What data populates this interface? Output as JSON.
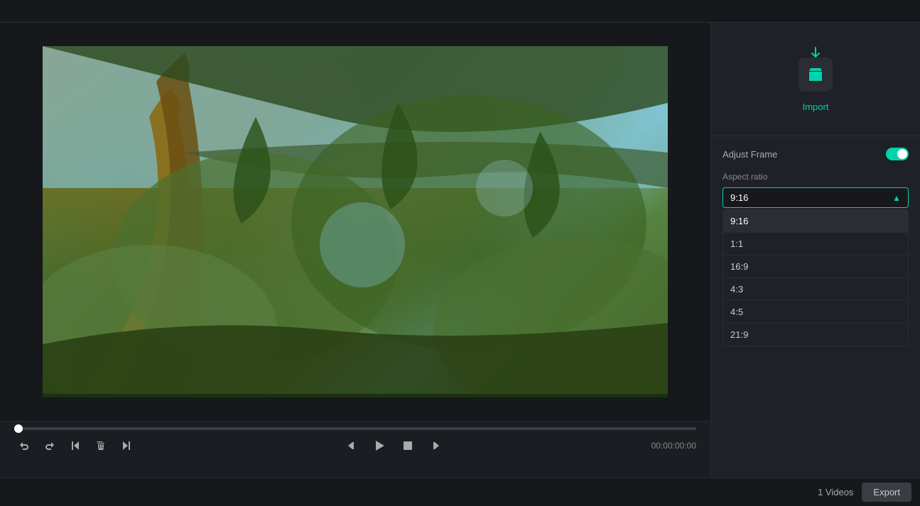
{
  "topbar": {},
  "import": {
    "label": "Import"
  },
  "adjustFrame": {
    "title": "Adjust Frame",
    "toggleEnabled": true,
    "aspectRatio": {
      "label": "Aspect ratio",
      "selected": "9:16",
      "options": [
        {
          "value": "9:16",
          "label": "9:16"
        },
        {
          "value": "1:1",
          "label": "1:1"
        },
        {
          "value": "16:9",
          "label": "16:9"
        },
        {
          "value": "4:3",
          "label": "4:3"
        },
        {
          "value": "4:5",
          "label": "4:5"
        },
        {
          "value": "21:9",
          "label": "21:9"
        }
      ]
    }
  },
  "controls": {
    "time": "00:00:00:00"
  },
  "bottomBar": {
    "videosCount": "1 Videos",
    "exportLabel": "Export"
  }
}
